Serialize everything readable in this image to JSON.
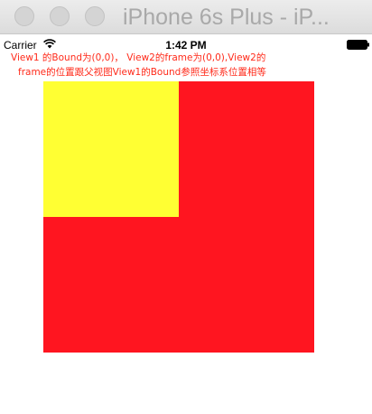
{
  "window": {
    "title": "iPhone 6s Plus - iP..."
  },
  "status_bar": {
    "carrier": "Carrier",
    "time": "1:42 PM",
    "wifi_icon": "wifi-icon",
    "battery_icon": "battery-icon"
  },
  "caption": {
    "line1": "View1 的Bound为(0,0)， View2的frame为(0,0),View2的",
    "line2": "frame的位置跟父视图View1的Bound参照坐标系位置相等"
  },
  "views": {
    "view1_color": "#ff1520",
    "view2_color": "#ffff33"
  }
}
